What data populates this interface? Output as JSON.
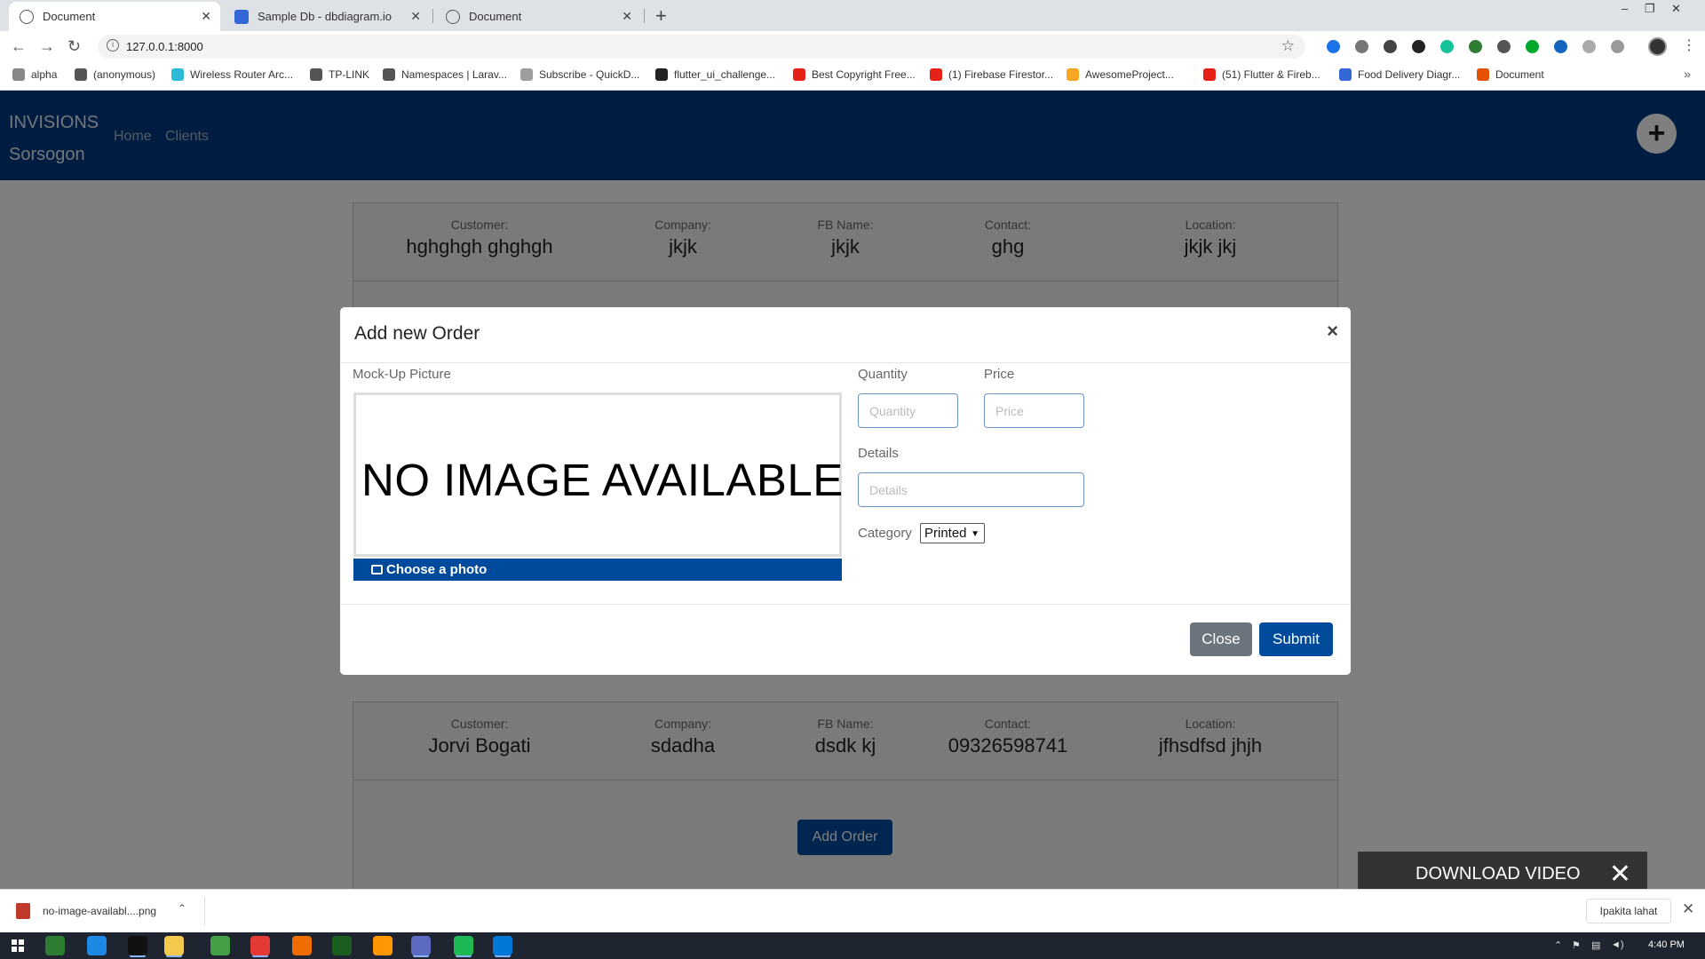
{
  "browser": {
    "tabs": [
      {
        "label": "Document",
        "active": true
      },
      {
        "label": "Sample Db - dbdiagram.io",
        "active": false
      },
      {
        "label": "Document",
        "active": false
      }
    ],
    "new_tab": "+",
    "window_controls": {
      "minimize": "–",
      "restore": "❐",
      "close": "✕"
    },
    "url": "127.0.0.1:8000",
    "bookmarks": [
      {
        "label": "alpha",
        "color": "#888888"
      },
      {
        "label": "(anonymous)",
        "color": "#555555"
      },
      {
        "label": "Wireless Router Arc...",
        "color": "#2bbbd8"
      },
      {
        "label": "TP-LINK",
        "color": "#555555"
      },
      {
        "label": "Namespaces | Larav...",
        "color": "#555555"
      },
      {
        "label": "Subscribe - QuickD...",
        "color": "#9e9e9e"
      },
      {
        "label": "flutter_ui_challenge...",
        "color": "#222222"
      },
      {
        "label": "Best Copyright Free...",
        "color": "#e62117"
      },
      {
        "label": "(1) Firebase Firestor...",
        "color": "#e62117"
      },
      {
        "label": "AwesomeProject...",
        "color": "#f5a623"
      },
      {
        "label": "(51) Flutter & Fireb...",
        "color": "#e62117"
      },
      {
        "label": "Food Delivery Diagr...",
        "color": "#3367d6"
      },
      {
        "label": "Document",
        "color": "#e65100"
      }
    ],
    "bookmarks_more": "»"
  },
  "navbar": {
    "brand_line1": "INVISIONS",
    "brand_line2": "Sorsogon",
    "links": [
      "Home",
      "Clients"
    ],
    "fab_label": "+",
    "color": "#003a82"
  },
  "customer_labels": {
    "customer": "Customer:",
    "company": "Company:",
    "fb": "FB Name:",
    "contact": "Contact:",
    "location": "Location:"
  },
  "customers": [
    {
      "customer": "hghghgh ghghgh",
      "company": "jkjk",
      "fb": "jkjk",
      "contact": "ghg",
      "location": "jkjk jkj"
    },
    {
      "customer": "Jorvi Bogati",
      "company": "sdadha",
      "fb": "dsdk kj",
      "contact": "09326598741",
      "location": "jfhsdfsd jhjh"
    }
  ],
  "add_order_label": "Add Order",
  "modal": {
    "title": "Add new Order",
    "close_x": "×",
    "mockup_label": "Mock-Up Picture",
    "no_image_text": "NO IMAGE AVAILABLE",
    "choose_photo": "Choose a photo",
    "quantity_label": "Quantity",
    "quantity_placeholder": "Quantity",
    "price_label": "Price",
    "price_placeholder": "Price",
    "details_label": "Details",
    "details_placeholder": "Details",
    "category_label": "Category",
    "category_value": "Printed",
    "close_button": "Close",
    "submit_button": "Submit",
    "primary_color": "#004a9c"
  },
  "download_video": {
    "label": "DOWNLOAD VIDEO",
    "close": "✕"
  },
  "downloads_bar": {
    "file": "no-image-availabl....png",
    "show_all": "Ipakita lahat",
    "close": "✕"
  },
  "taskbar": {
    "time": "4:40 PM"
  }
}
